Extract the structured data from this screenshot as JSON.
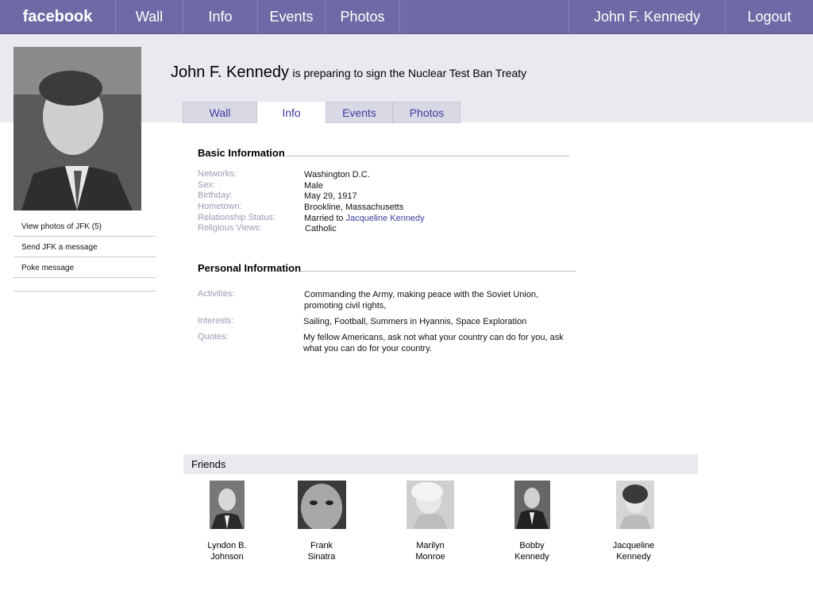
{
  "topnav": {
    "brand": "facebook",
    "items": [
      "Wall",
      "Info",
      "Events",
      "Photos"
    ],
    "user": "John F. Kennedy",
    "logout": "Logout"
  },
  "profile": {
    "name": "John F. Kennedy",
    "status": "is preparing to sign the Nuclear Test Ban Treaty",
    "tabs": [
      "Wall",
      "Info",
      "Events",
      "Photos"
    ],
    "active_tab": "Info"
  },
  "sidebar": {
    "links": [
      "View photos of JFK (5)",
      "Send JFK a message",
      "Poke message"
    ]
  },
  "basic_info": {
    "title": "Basic Information",
    "rows": [
      {
        "label": "Networks:",
        "value": "Washington D.C."
      },
      {
        "label": "Sex:",
        "value": "Male"
      },
      {
        "label": "Birthday:",
        "value": "May 29, 1917"
      },
      {
        "label": "Hometown:",
        "value": "Brookline, Massachusetts"
      },
      {
        "label": "Relationship Status:",
        "value": "Married to",
        "link": "Jacqueline Kennedy"
      },
      {
        "label": "Religious Views:",
        "value": "Catholic"
      }
    ]
  },
  "personal_info": {
    "title": "Personal Information",
    "rows": [
      {
        "label": "Activities:",
        "value": "Commanding the Army, making peace with the Soviet Union, promoting civil rights,"
      },
      {
        "label": "Interests:",
        "value": "Sailing, Football, Summers in Hyannis, Space Exploration"
      },
      {
        "label": "Quotes:",
        "value": "My fellow Americans, ask not what your country can do for you, ask what you can do for your country."
      }
    ]
  },
  "friends": {
    "title": "Friends",
    "items": [
      {
        "first": "Lyndon B.",
        "last": "Johnson"
      },
      {
        "first": "Frank",
        "last": "Sinatra"
      },
      {
        "first": "Marilyn",
        "last": "Monroe"
      },
      {
        "first": "Bobby",
        "last": "Kennedy"
      },
      {
        "first": "Jacqueline",
        "last": "Kennedy"
      }
    ]
  },
  "colors": {
    "topbar": "#6d6aa6",
    "band": "#e9e9ef",
    "link": "#3b3b9e",
    "label": "#9a9ab2"
  },
  "icons": {
    "profile_photo": "person-photo",
    "friend_photo": "person-photo"
  }
}
